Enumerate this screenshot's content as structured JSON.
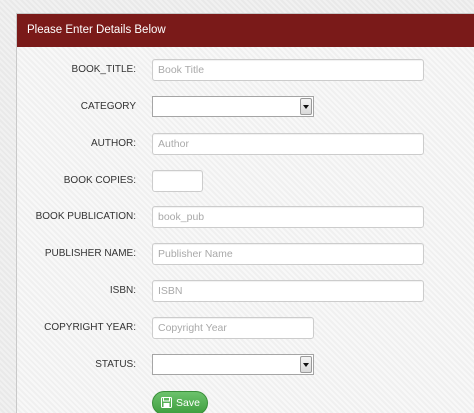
{
  "panel": {
    "title": "Please Enter Details Below"
  },
  "form": {
    "book_title": {
      "label": "BOOK_TITLE:",
      "value": "",
      "placeholder": "Book Title"
    },
    "category": {
      "label": "CATEGORY",
      "value": ""
    },
    "author": {
      "label": "AUTHOR:",
      "value": "",
      "placeholder": "Author"
    },
    "book_copies": {
      "label": "BOOK COPIES:",
      "value": "",
      "placeholder": ""
    },
    "book_publication": {
      "label": "BOOK PUBLICATION:",
      "value": "",
      "placeholder": "book_pub"
    },
    "publisher_name": {
      "label": "PUBLISHER NAME:",
      "value": "",
      "placeholder": "Publisher Name"
    },
    "isbn": {
      "label": "ISBN:",
      "value": "",
      "placeholder": "ISBN"
    },
    "copyright_year": {
      "label": "COPYRIGHT YEAR:",
      "value": "",
      "placeholder": "Copyright Year"
    },
    "status": {
      "label": "STATUS:",
      "value": ""
    },
    "save_label": "Save",
    "save_icon": "floppy-disk-icon"
  },
  "colors": {
    "header_bg": "#7a1a19",
    "save_button": "#4aa84a"
  }
}
